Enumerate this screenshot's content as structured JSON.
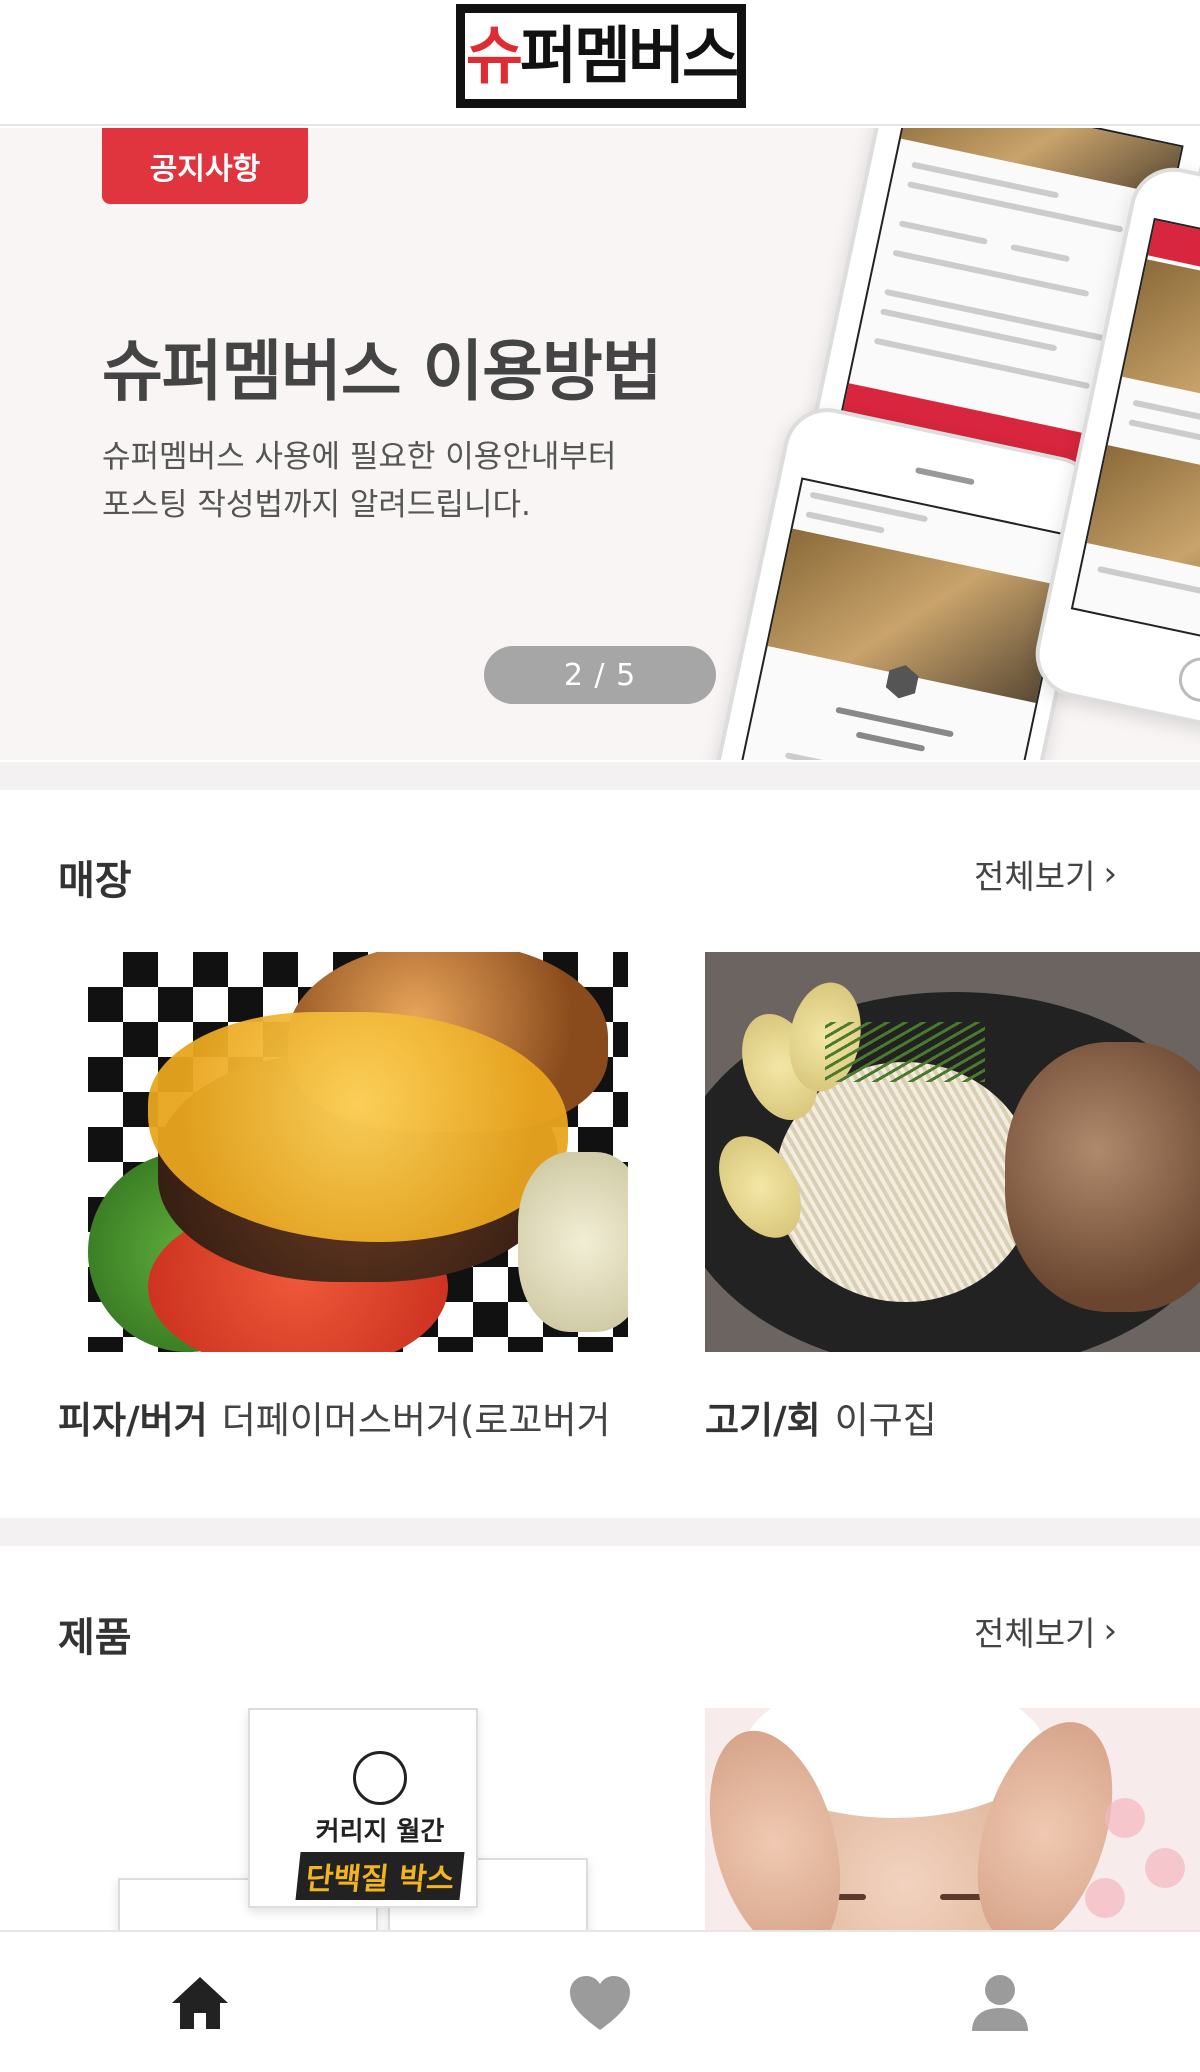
{
  "header": {
    "logo_text_accent": "슈",
    "logo_text_rest": "퍼멤버스"
  },
  "banner": {
    "badge": "공지사항",
    "title": "슈퍼멤버스 이용방법",
    "desc_line1": "슈퍼멤버스 사용에 필요한 이용안내부터",
    "desc_line2": "포스팅 작성법까지 알려드립니다.",
    "pager": "2 / 5"
  },
  "stores": {
    "title": "매장",
    "see_all": "전체보기",
    "items": [
      {
        "category": "피자/버거",
        "name": "더페이머스버거(로꼬버거"
      },
      {
        "category": "고기/회",
        "name": "이구집"
      }
    ]
  },
  "products": {
    "title": "제품",
    "see_all": "전체보기",
    "box_line1": "커리지 월간",
    "box_line2": "단백질 박스"
  },
  "tabbar": {
    "icons": [
      "home-icon",
      "heart-icon",
      "person-icon"
    ],
    "active": "home-icon"
  },
  "colors": {
    "accent": "#e0353f",
    "tab_active": "#222222",
    "tab_inactive": "#9b9b9b"
  }
}
